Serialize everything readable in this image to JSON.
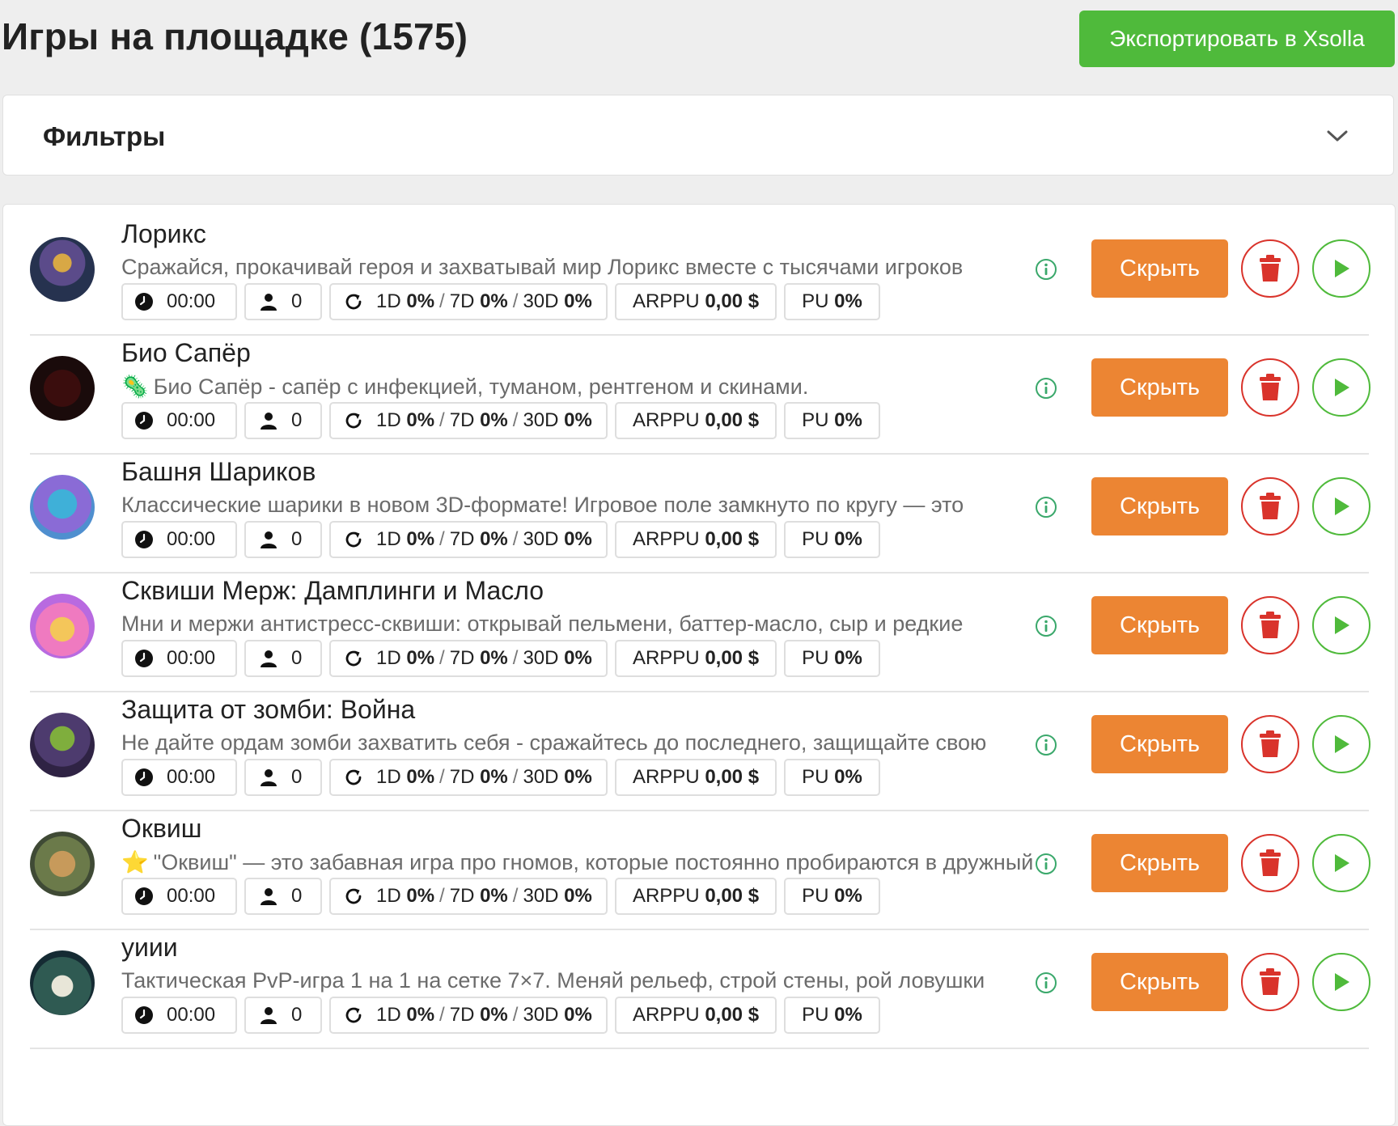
{
  "header": {
    "title": "Игры на площадке (1575)",
    "export_label": "Экспортировать в Xsolla"
  },
  "filters": {
    "title": "Фильтры"
  },
  "actions": {
    "hide_label": "Скрыть"
  },
  "colors": {
    "export_green": "#4fba3b",
    "hide_orange": "#ec8533",
    "delete_red": "#d9332b",
    "play_green": "#4fba3b",
    "info_green": "#3aa86b"
  },
  "games": [
    {
      "title": "Лорикс",
      "emoji": "",
      "description": "Сражайся, прокачивай героя и захватывай мир Лорикс вместе с тысячами игроков",
      "time": "00:00",
      "users": "0",
      "d1": "0%",
      "d7": "0%",
      "d30": "0%",
      "arppu": "0,00 $",
      "pu": "0%"
    },
    {
      "title": "Био Сапёр",
      "emoji": "🦠",
      "description": "Био Сапёр - сапёр с инфекцией, туманом, рентгеном и скинами.",
      "time": "00:00",
      "users": "0",
      "d1": "0%",
      "d7": "0%",
      "d30": "0%",
      "arppu": "0,00 $",
      "pu": "0%"
    },
    {
      "title": "Башня Шариков",
      "emoji": "",
      "description": "Классические шарики в новом 3D-формате! Игровое поле замкнуто по кругу — это",
      "time": "00:00",
      "users": "0",
      "d1": "0%",
      "d7": "0%",
      "d30": "0%",
      "arppu": "0,00 $",
      "pu": "0%"
    },
    {
      "title": "Сквиши Мерж: Дамплинги и Масло",
      "emoji": "",
      "description": "Мни и мержи антистресс-сквиши: открывай пельмени, баттер-масло, сыр и редкие",
      "time": "00:00",
      "users": "0",
      "d1": "0%",
      "d7": "0%",
      "d30": "0%",
      "arppu": "0,00 $",
      "pu": "0%"
    },
    {
      "title": "Защита от зомби: Война",
      "emoji": "",
      "description": "Не дайте ордам зомби захватить себя - сражайтесь до последнего, защищайте свою",
      "time": "00:00",
      "users": "0",
      "d1": "0%",
      "d7": "0%",
      "d30": "0%",
      "arppu": "0,00 $",
      "pu": "0%"
    },
    {
      "title": "Оквиш",
      "emoji": "⭐",
      "description": "\"Оквиш\" — это забавная игра про гномов, которые постоянно пробираются в дружный",
      "time": "00:00",
      "users": "0",
      "d1": "0%",
      "d7": "0%",
      "d30": "0%",
      "arppu": "0,00 $",
      "pu": "0%"
    },
    {
      "title": "уиии",
      "emoji": "",
      "description": "Тактическая PvP-игра 1 на 1 на сетке 7×7. Меняй рельеф, строй стены, рой ловушки",
      "time": "00:00",
      "users": "0",
      "d1": "0%",
      "d7": "0%",
      "d30": "0%",
      "arppu": "0,00 $",
      "pu": "0%"
    }
  ],
  "stat_labels": {
    "d1": "1D",
    "d7": "7D",
    "d30": "30D",
    "arppu": "ARPPU",
    "pu": "PU",
    "sep": "/"
  }
}
